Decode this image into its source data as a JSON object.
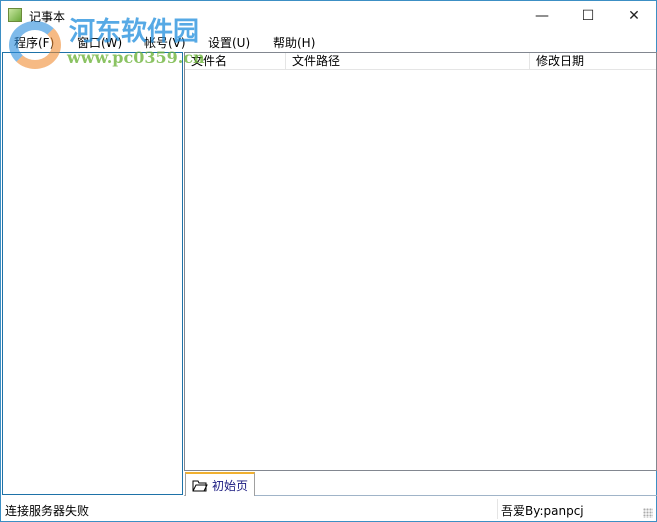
{
  "window": {
    "title": "记事本",
    "minimize": "—",
    "maximize": "☐",
    "close": "✕"
  },
  "menu": [
    {
      "label": "程序(F)"
    },
    {
      "label": "窗口(W)"
    },
    {
      "label": "帐号(V)"
    },
    {
      "label": "设置(U)"
    },
    {
      "label": "帮助(H)"
    }
  ],
  "list": {
    "columns": [
      "文件名",
      "文件路径",
      "修改日期"
    ]
  },
  "tabs": [
    {
      "label": "初始页",
      "icon": "folder-icon"
    }
  ],
  "status": {
    "left": "连接服务器失败",
    "right": "吾爱By:panpcj"
  },
  "watermark": {
    "name": "河东软件园",
    "url": "www.pc0359.cn"
  },
  "colors": {
    "border": "#3c8fc4",
    "tab_accent": "#f0b030"
  }
}
